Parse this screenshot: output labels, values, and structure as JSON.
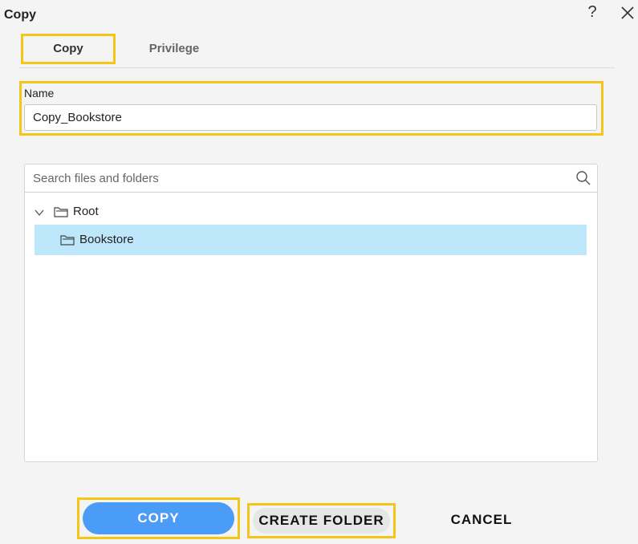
{
  "dialog": {
    "title": "Copy",
    "help_icon": "question-mark-icon",
    "close_icon": "close-icon"
  },
  "tabs": [
    {
      "label": "Copy",
      "selected": true
    },
    {
      "label": "Privilege",
      "selected": false
    }
  ],
  "name_field": {
    "label": "Name",
    "value": "Copy_Bookstore"
  },
  "search": {
    "placeholder": "Search files and folders",
    "icon": "search-icon"
  },
  "tree": {
    "root": {
      "label": "Root",
      "expanded": true,
      "icon": "folder-icon"
    },
    "children": [
      {
        "label": "Bookstore",
        "selected": true,
        "icon": "folder-icon"
      }
    ]
  },
  "buttons": {
    "copy": "COPY",
    "create_folder": "CREATE FOLDER",
    "cancel": "CANCEL"
  },
  "colors": {
    "highlight": "#f5c518",
    "primary": "#4a9cf7",
    "selected_row": "#bfe7fc"
  }
}
